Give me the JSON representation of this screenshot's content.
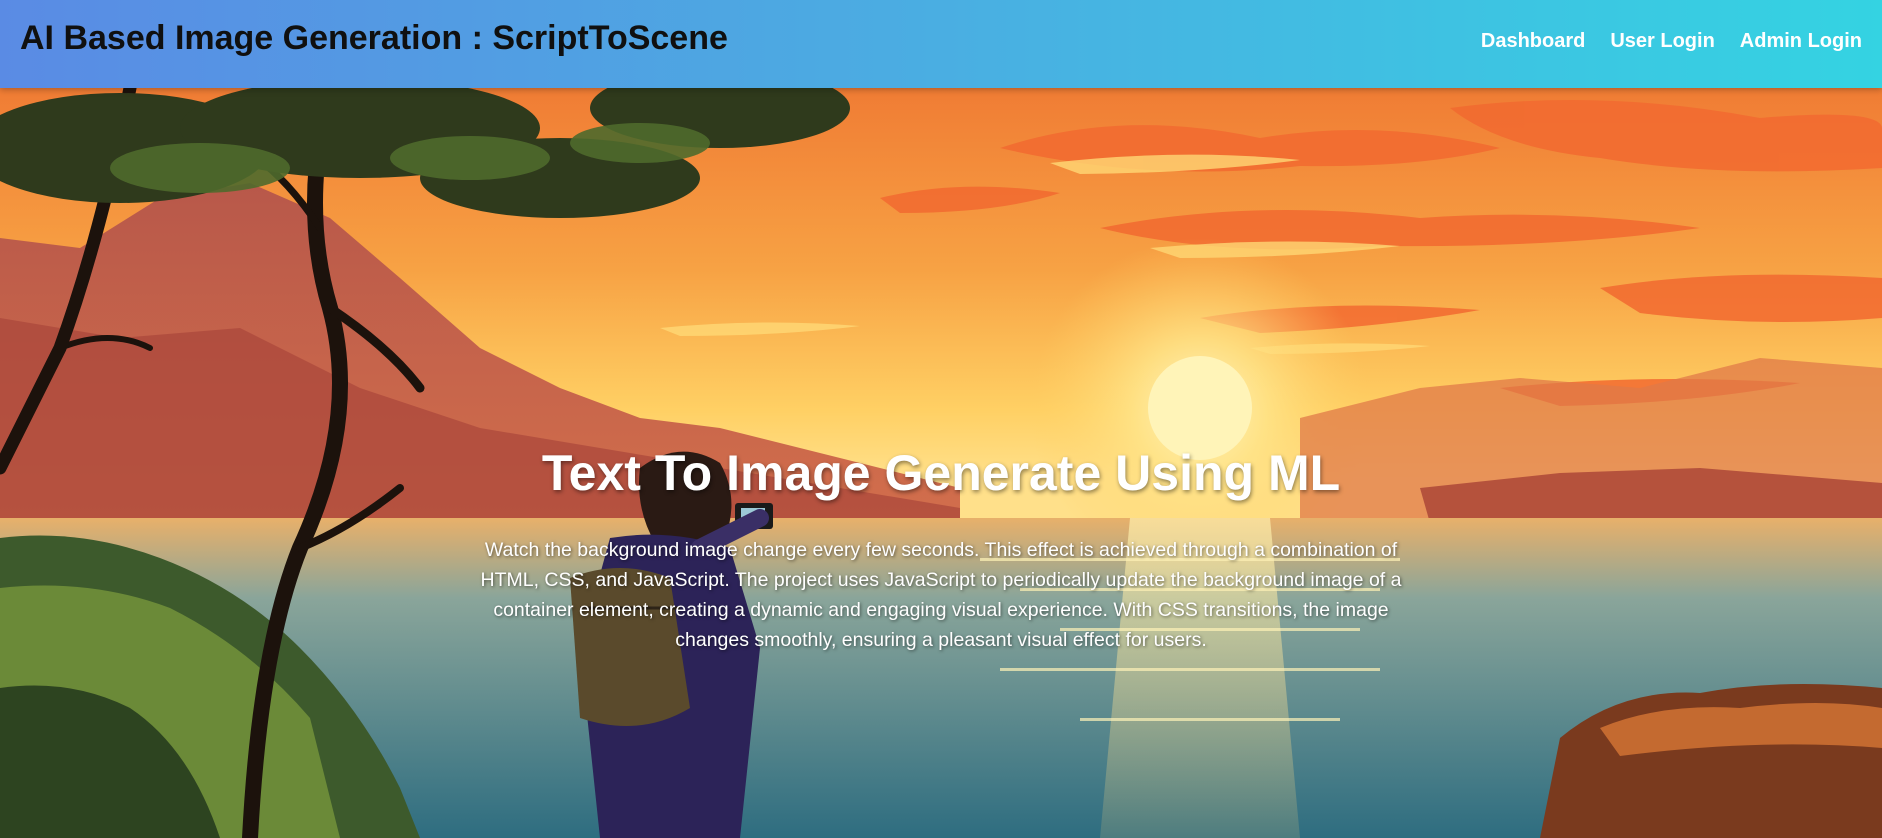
{
  "header": {
    "brand_title": "AI Based Image Generation : ScriptToScene",
    "nav": [
      {
        "label": "Dashboard"
      },
      {
        "label": "User Login"
      },
      {
        "label": "Admin Login"
      }
    ]
  },
  "hero": {
    "title": "Text To Image Generate Using ML",
    "description": "Watch the background image change every few seconds. This effect is achieved through a combination of HTML, CSS, and JavaScript. The project uses JavaScript to periodically update the background image of a container element, creating a dynamic and engaging visual experience. With CSS transitions, the image changes smoothly, ensuring a pleasant visual effect for users.",
    "background": "sunset-lake-illustration"
  },
  "colors": {
    "navbar_start": "#5a8be4",
    "navbar_end": "#34d3e2",
    "brand_text": "#101010",
    "nav_text": "#ffffff",
    "sky_top": "#f28a3a",
    "sky_horizon": "#ffd56a",
    "water": "#3c7a8e"
  }
}
